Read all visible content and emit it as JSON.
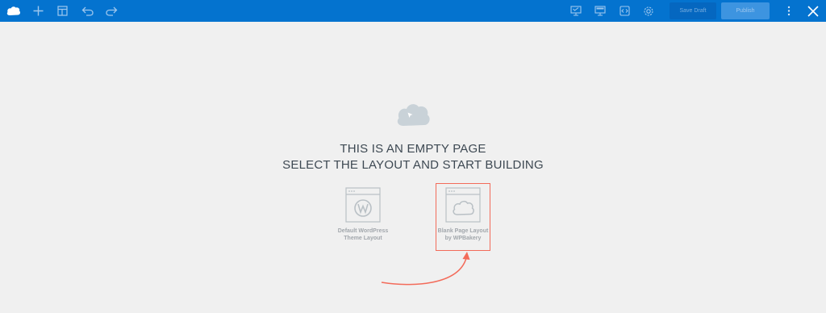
{
  "toolbar": {
    "icons": {
      "logo": "wpbakery-cloud-logo",
      "add": "plus-icon",
      "templates": "layout-templates-icon",
      "undo": "undo-icon",
      "redo": "redo-icon",
      "responsive": "responsive-preview-icon",
      "screen": "monitor-icon",
      "code": "custom-code-icon",
      "settings": "gear-icon",
      "more": "more-vertical-icon",
      "close": "close-icon"
    },
    "save_draft_label": "Save Draft",
    "publish_label": "Publish",
    "bar_color": "#0473cf"
  },
  "main": {
    "heading_line1": "THIS IS AN EMPTY PAGE",
    "heading_line2": "SELECT THE LAYOUT AND START BUILDING",
    "layouts": [
      {
        "label": "Default WordPress\nTheme Layout",
        "icon": "wordpress-icon"
      },
      {
        "label": "Blank Page Layout\nby WPBakery",
        "icon": "cloud-icon",
        "highlighted": true
      }
    ],
    "annotation_color": "#f36b5a"
  }
}
